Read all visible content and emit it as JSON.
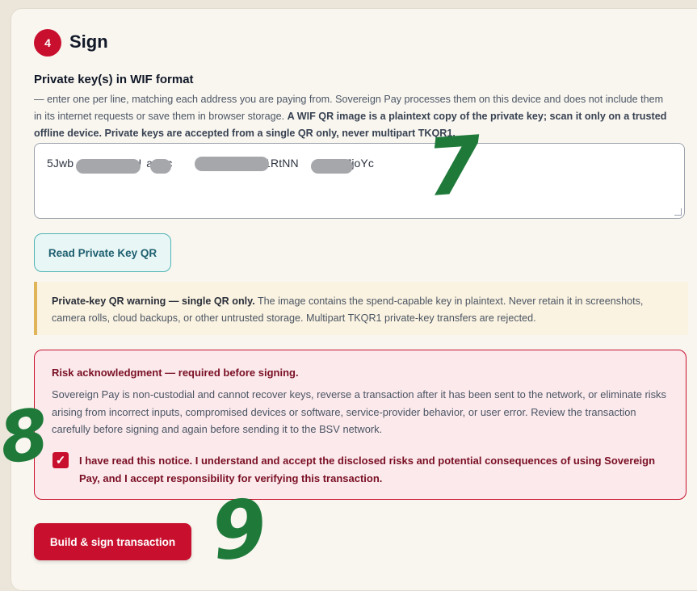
{
  "step": {
    "number": "4",
    "title": "Sign"
  },
  "private_key_field": {
    "label": "Private key(s) in WIF format",
    "help_text": "— enter one per line, matching each address you are paying from. Sovereign Pay processes them on this device and does not include them in its internet requests or save them in browser storage.",
    "help_bold": "A WIF QR image is a plaintext copy of the private key; scan it only on a trusted offline device. Private keys are accepted from a single QR only, never multipart TKQR1.",
    "value_segments": [
      "5Jwb",
      "7U",
      "aSnc",
      "AR1RtNN",
      "297joYc"
    ]
  },
  "read_qr_button": {
    "label": "Read Private Key QR"
  },
  "qr_warning": {
    "bold": "Private-key QR warning — single QR only.",
    "text": "The image contains the spend-capable key in plaintext. Never retain it in screenshots, camera rolls, cloud backups, or other untrusted storage. Multipart TKQR1 private-key transfers are rejected."
  },
  "risk": {
    "title": "Risk acknowledgment — required before signing.",
    "body": "Sovereign Pay is non-custodial and cannot recover keys, reverse a transaction after it has been sent to the network, or eliminate risks arising from incorrect inputs, compromised devices or software, service-provider behavior, or user error. Review the transaction carefully before signing and again before sending it to the BSV network.",
    "ack_checked": true,
    "ack_label": "I have read this notice. I understand and accept the disclosed risks and potential consequences of using Sovereign Pay, and I accept responsibility for verifying this transaction."
  },
  "build_button": {
    "label": "Build & sign transaction"
  },
  "annotations": [
    "7",
    "8",
    "9"
  ],
  "colors": {
    "accent": "#c8102e",
    "teal": "#4fb3b3",
    "warning_border": "#e0b55a",
    "annotation": "#1f7a3a"
  }
}
